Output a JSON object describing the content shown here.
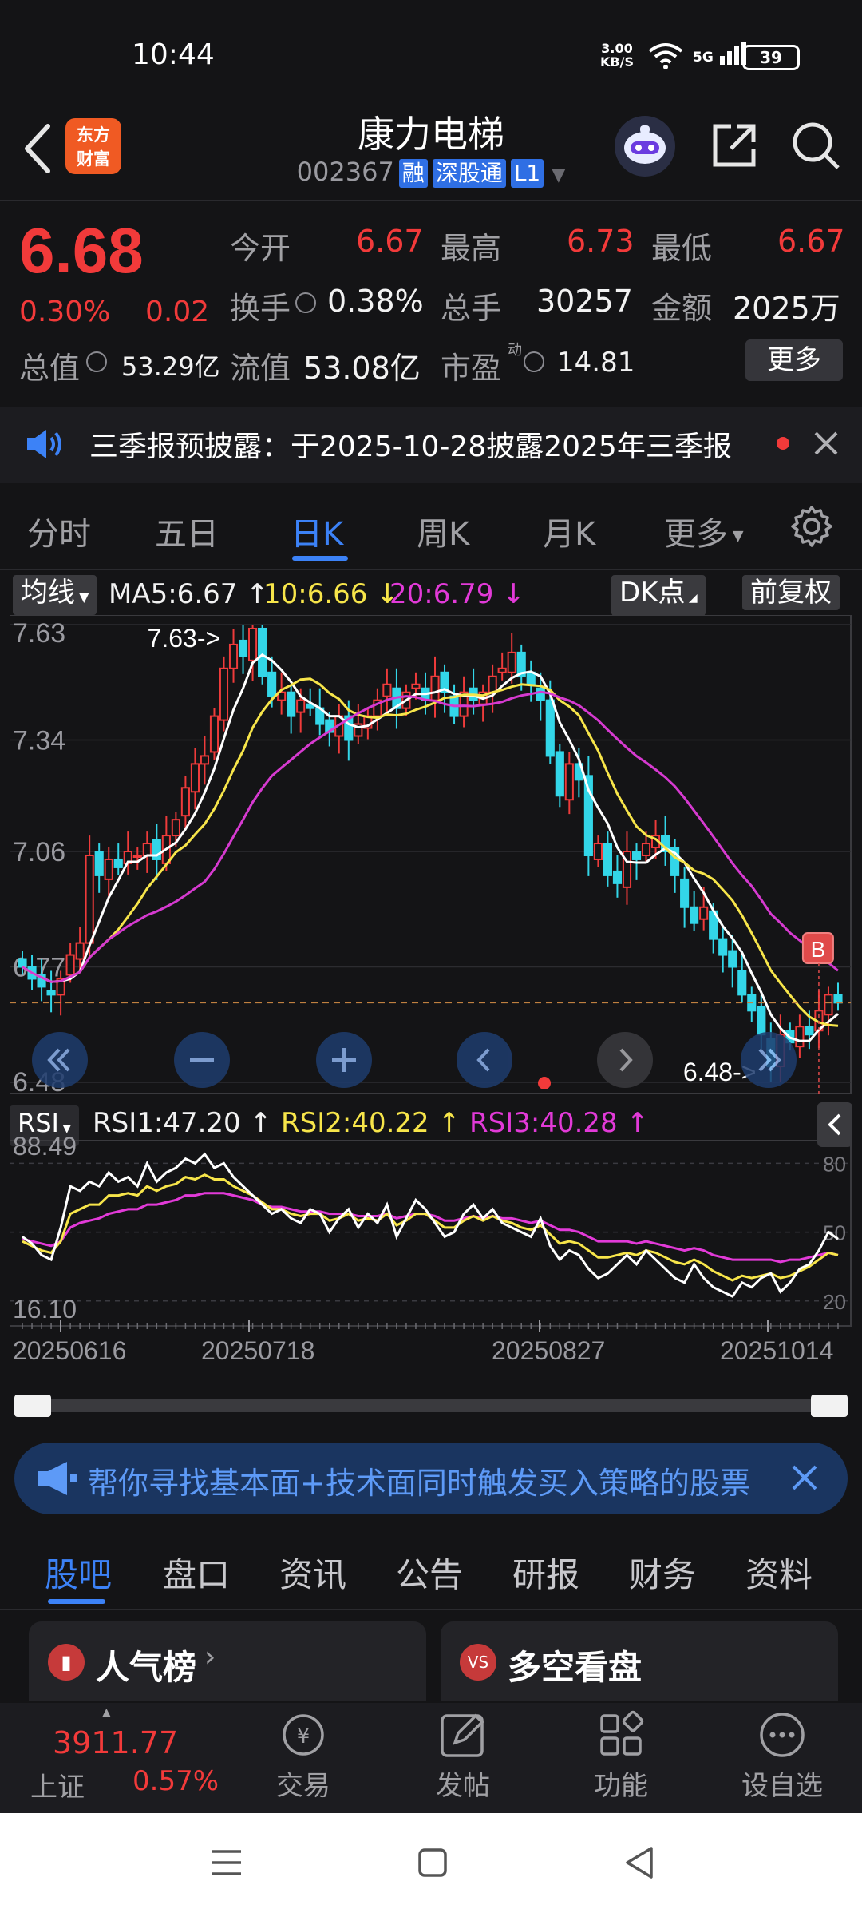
{
  "status_bar": {
    "time": "10:44",
    "net_speed_value": "3.00",
    "net_speed_unit": "KB/S",
    "network": "5G",
    "battery": "39"
  },
  "header": {
    "logo_line1": "东方",
    "logo_line2": "财富",
    "stock_name": "康力电梯",
    "stock_code": "002367",
    "tags": [
      "融",
      "深股通",
      "L1"
    ]
  },
  "quote": {
    "price": "6.68",
    "change_pct": "0.30%",
    "change": "0.02",
    "open_label": "今开",
    "open": "6.67",
    "high_label": "最高",
    "high": "6.73",
    "low_label": "最低",
    "low": "6.67",
    "turnover_label": "换手",
    "turnover": "0.38%",
    "volume_label": "总手",
    "volume": "30257",
    "amount_label": "金额",
    "amount": "2025万",
    "mcap_label": "总值",
    "mcap": "53.29亿",
    "float_label": "流值",
    "float": "53.08亿",
    "pe_label": "市盈",
    "pe_sup": "动",
    "pe": "14.81",
    "more": "更多"
  },
  "notice": {
    "text": "三季报预披露：于2025-10-28披露2025年三季报"
  },
  "period_tabs": [
    "分时",
    "五日",
    "日K",
    "周K",
    "月K",
    "更多"
  ],
  "ma_bar": {
    "indicator": "均线",
    "ma5": "MA5:6.67",
    "ma10": "10:6.66",
    "ma20": "20:6.79",
    "dk": "DK点",
    "adjust": "前复权"
  },
  "chart_data": [
    {
      "type": "candlestick",
      "ylim": [
        6.48,
        7.63
      ],
      "y_ticks": [
        "7.63",
        "7.34",
        "7.06",
        "6.77",
        "6.48"
      ],
      "max_annotation": "7.63->",
      "min_annotation": "6.48->",
      "signal_marker": "B",
      "colors": {
        "up": "#ef3b3b",
        "down": "#33d6e8",
        "ma5": "#ffffff",
        "ma10": "#f7e54a",
        "ma20": "#d63ad0"
      },
      "x_labels": [
        "20250616",
        "20250718",
        "20250827",
        "20251014"
      ],
      "close": [
        6.77,
        6.74,
        6.72,
        6.7,
        6.74,
        6.8,
        6.83,
        7.05,
        7.0,
        7.04,
        7.02,
        7.06,
        7.05,
        7.08,
        7.04,
        7.1,
        7.14,
        7.22,
        7.28,
        7.3,
        7.4,
        7.52,
        7.58,
        7.55,
        7.62,
        7.5,
        7.45,
        7.46,
        7.4,
        7.44,
        7.42,
        7.38,
        7.36,
        7.4,
        7.34,
        7.38,
        7.4,
        7.44,
        7.48,
        7.42,
        7.46,
        7.48,
        7.44,
        7.5,
        7.46,
        7.4,
        7.46,
        7.44,
        7.46,
        7.5,
        7.52,
        7.56,
        7.5,
        7.48,
        7.44,
        7.3,
        7.2,
        7.28,
        7.24,
        7.05,
        7.08,
        7.0,
        6.98,
        7.06,
        7.04,
        7.08,
        7.1,
        7.06,
        7.0,
        6.92,
        6.88,
        6.92,
        6.84,
        6.8,
        6.77,
        6.7,
        6.66,
        6.6,
        6.52,
        6.6,
        6.58,
        6.62,
        6.6,
        6.66,
        6.7,
        6.68
      ]
    },
    {
      "type": "line",
      "name": "RSI",
      "ylim": [
        16.1,
        88.49
      ],
      "y_ticks_left": [
        "88.49",
        "16.10"
      ],
      "y_ticks_right": [
        "80",
        "50",
        "20"
      ],
      "series": [
        {
          "name": "RSI1:47.20",
          "color": "#ffffff",
          "values": [
            48,
            45,
            40,
            38,
            52,
            70,
            68,
            72,
            70,
            76,
            72,
            74,
            70,
            80,
            72,
            76,
            78,
            82,
            80,
            84,
            78,
            80,
            74,
            70,
            66,
            62,
            58,
            60,
            56,
            54,
            60,
            58,
            50,
            56,
            60,
            52,
            58,
            54,
            62,
            48,
            56,
            64,
            60,
            54,
            48,
            50,
            58,
            62,
            56,
            60,
            54,
            52,
            50,
            48,
            56,
            44,
            38,
            42,
            40,
            34,
            30,
            32,
            36,
            40,
            36,
            42,
            38,
            34,
            30,
            28,
            36,
            30,
            26,
            24,
            22,
            28,
            26,
            30,
            32,
            24,
            28,
            34,
            36,
            42,
            50,
            47
          ]
        },
        {
          "name": "RSI2:40.22",
          "color": "#f7e54a",
          "values": [
            46,
            44,
            42,
            41,
            46,
            58,
            60,
            62,
            62,
            66,
            66,
            67,
            66,
            70,
            68,
            70,
            71,
            74,
            73,
            75,
            73,
            73,
            70,
            68,
            66,
            63,
            60,
            60,
            58,
            57,
            58,
            58,
            55,
            56,
            58,
            55,
            56,
            55,
            58,
            53,
            55,
            58,
            58,
            55,
            52,
            52,
            55,
            57,
            55,
            57,
            55,
            54,
            52,
            51,
            53,
            49,
            45,
            46,
            45,
            42,
            39,
            39,
            40,
            41,
            40,
            42,
            41,
            39,
            37,
            36,
            38,
            36,
            33,
            31,
            29,
            31,
            30,
            31,
            32,
            30,
            31,
            33,
            35,
            38,
            41,
            40
          ]
        },
        {
          "name": "RSI3:40.28",
          "color": "#e23ad8",
          "values": [
            47,
            46,
            45,
            44,
            46,
            52,
            54,
            55,
            56,
            58,
            59,
            60,
            60,
            62,
            62,
            63,
            64,
            66,
            66,
            67,
            67,
            67,
            66,
            65,
            64,
            62,
            61,
            61,
            60,
            59,
            59,
            59,
            58,
            58,
            58,
            57,
            57,
            57,
            58,
            56,
            57,
            58,
            58,
            57,
            55,
            55,
            56,
            57,
            56,
            57,
            56,
            56,
            55,
            54,
            55,
            53,
            51,
            51,
            50,
            48,
            46,
            46,
            46,
            46,
            45,
            46,
            45,
            44,
            43,
            42,
            43,
            42,
            40,
            39,
            38,
            38,
            38,
            38,
            38,
            37,
            38,
            38,
            39,
            40,
            41,
            40
          ]
        }
      ],
      "x_labels": [
        "20250616",
        "20250718",
        "20250827",
        "20251014"
      ]
    }
  ],
  "banner": {
    "text": "帮你寻找基本面+技术面同时触发买入策略的股票"
  },
  "content_tabs": [
    "股吧",
    "盘口",
    "资讯",
    "公告",
    "研报",
    "财务",
    "资料"
  ],
  "cards": [
    "人气榜",
    "多空看盘"
  ],
  "bottom_bar": {
    "index_value": "3911.77",
    "index_name": "上证",
    "index_pct": "0.57%",
    "trade": "交易",
    "post": "发帖",
    "function": "功能",
    "watch": "设自选"
  }
}
